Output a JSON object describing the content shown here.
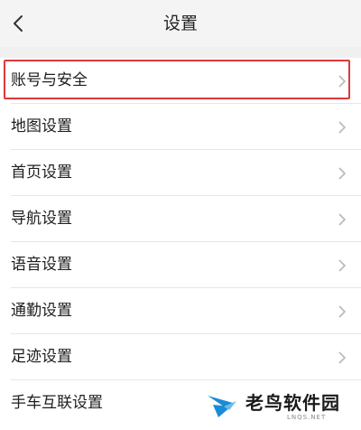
{
  "header": {
    "back_icon": "chevron-left-icon",
    "title": "设置"
  },
  "settings": {
    "items": [
      {
        "label": "账号与安全",
        "highlighted": true
      },
      {
        "label": "地图设置"
      },
      {
        "label": "首页设置"
      },
      {
        "label": "导航设置"
      },
      {
        "label": "语音设置"
      },
      {
        "label": "通勤设置"
      },
      {
        "label": "足迹设置"
      },
      {
        "label": "手车互联设置"
      }
    ],
    "chevron_icon": "chevron-right-icon",
    "highlight_color": "#d93a3a"
  },
  "watermark": {
    "text": "老鸟软件园",
    "subtext": "LNQS.NET",
    "logo_icon": "bird-logo-icon",
    "logo_color": "#1a8bd6"
  }
}
